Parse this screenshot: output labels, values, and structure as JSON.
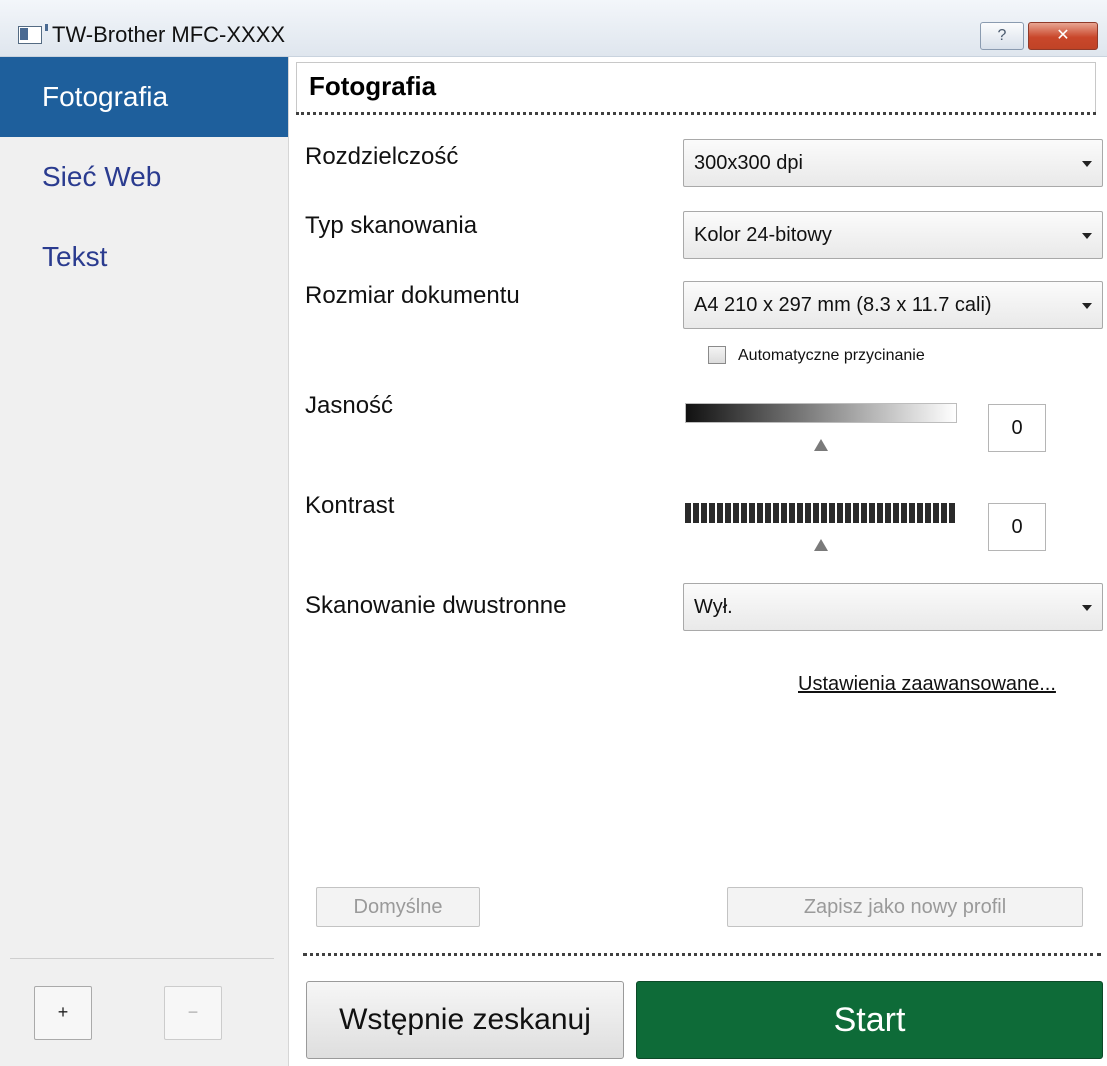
{
  "window": {
    "title": "TW-Brother MFC-XXXX",
    "help_label": "?",
    "close_label": "✕"
  },
  "sidebar": {
    "items": [
      {
        "label": "Fotografia",
        "active": true
      },
      {
        "label": "Sieć Web",
        "active": false
      },
      {
        "label": "Tekst",
        "active": false
      }
    ],
    "add_label": "+",
    "remove_label": "−"
  },
  "profile": {
    "name": "Fotografia"
  },
  "settings": {
    "resolution": {
      "label": "Rozdzielczość",
      "value": "300x300 dpi"
    },
    "scan_type": {
      "label": "Typ skanowania",
      "value": "Kolor 24-bitowy"
    },
    "document_size": {
      "label": "Rozmiar dokumentu",
      "value": "A4 210 x 297 mm (8.3 x 11.7 cali)"
    },
    "auto_crop": {
      "label": "Automatyczne przycinanie",
      "checked": false
    },
    "brightness": {
      "label": "Jasność",
      "value": "0"
    },
    "contrast": {
      "label": "Kontrast",
      "value": "0"
    },
    "duplex": {
      "label": "Skanowanie dwustronne",
      "value": "Wył."
    }
  },
  "advanced_link": "Ustawienia zaawansowane...",
  "buttons": {
    "default": "Domyślne",
    "save_profile": "Zapisz jako nowy profil",
    "prescan": "Wstępnie zeskanuj",
    "start": "Start"
  },
  "colors": {
    "sidebar_active": "#1e5f9c",
    "sidebar_text": "#2a3b8f",
    "start_button": "#0e6b38"
  }
}
